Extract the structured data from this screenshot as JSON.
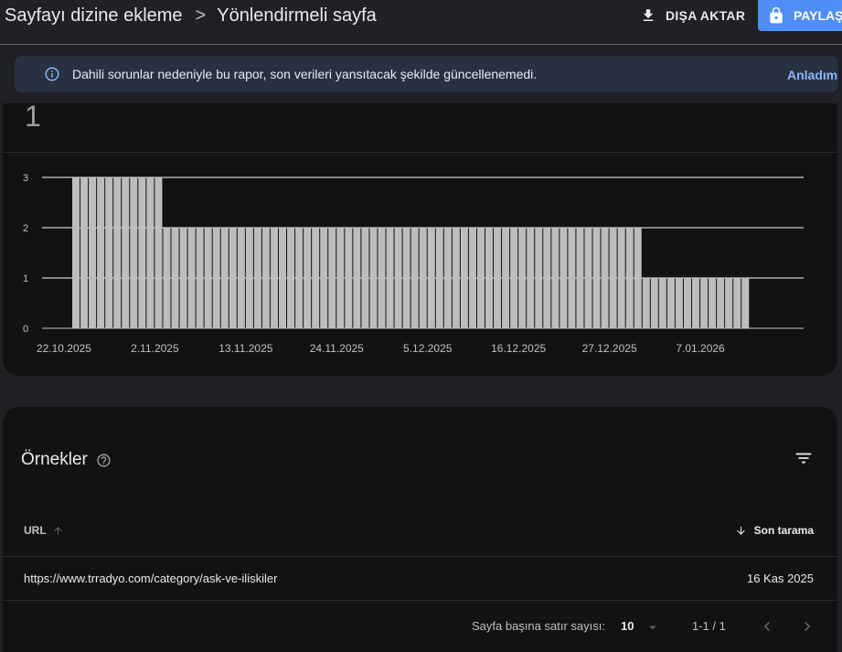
{
  "header": {
    "breadcrumb_parent": "Sayfayı dizine ekleme",
    "breadcrumb_separator": ">",
    "breadcrumb_current": "Yönlendirmeli sayfa",
    "export_label": "DIŞA AKTAR",
    "share_label": "PAYLAŞ"
  },
  "notice": {
    "message": "Dahili sorunlar nedeniyle bu rapor, son verileri yansıtacak şekilde güncellenemedi.",
    "ack_label": "Anladım"
  },
  "summary": {
    "total": "1"
  },
  "chart_data": {
    "type": "bar",
    "ylim": [
      0,
      3
    ],
    "yticks": [
      0,
      1,
      2,
      3
    ],
    "grid": true,
    "start_date": "22.10.2025",
    "xtick_labels": [
      "22.10.2025",
      "2.11.2025",
      "13.11.2025",
      "24.11.2025",
      "5.12.2025",
      "16.12.2025",
      "27.12.2025",
      "7.01.2026"
    ],
    "segments": [
      {
        "from": "23.10.2025",
        "to": "02.11.2025",
        "value": 3
      },
      {
        "from": "03.11.2025",
        "to": "30.12.2025",
        "value": 2
      },
      {
        "from": "31.12.2025",
        "to": "12.01.2026",
        "value": 1
      }
    ],
    "bar_color": "#bdbdbd"
  },
  "samples": {
    "title": "Örnekler",
    "columns": {
      "url": "URL",
      "last_crawl": "Son tarama"
    },
    "rows": [
      {
        "url": "https://www.trradyo.com/category/ask-ve-iliskiler",
        "date": "16 Kas 2025"
      }
    ],
    "pagination": {
      "rows_per_page_label": "Sayfa başına satır sayısı:",
      "rows_per_page": "10",
      "range": "1-1 / 1"
    }
  },
  "colors": {
    "accent": "#4f8df7",
    "link": "#8ab4f8",
    "notice_bg": "#283142"
  }
}
